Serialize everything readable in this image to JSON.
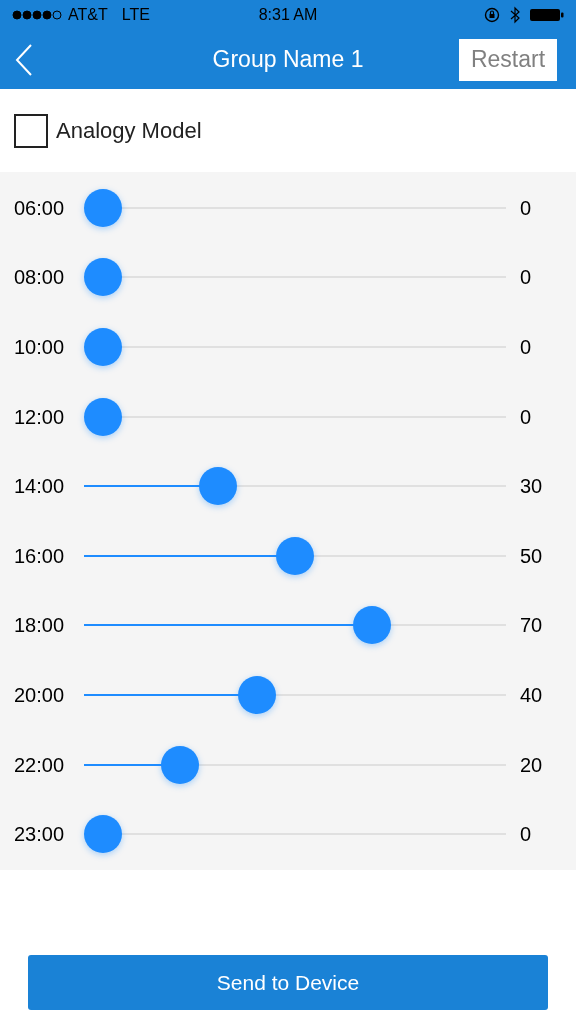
{
  "status_bar": {
    "carrier": "AT&T",
    "network": "LTE",
    "time": "8:31 AM"
  },
  "header": {
    "title": "Group Name 1",
    "action": "Restart"
  },
  "analogy_model": {
    "label": "Analogy Model",
    "checked": false
  },
  "sliders": [
    {
      "time": "06:00",
      "level": 0,
      "reading": "0"
    },
    {
      "time": "08:00",
      "level": 0,
      "reading": "0"
    },
    {
      "time": "10:00",
      "level": 0,
      "reading": "0"
    },
    {
      "time": "12:00",
      "level": 0,
      "reading": "0"
    },
    {
      "time": "14:00",
      "level": 0.3,
      "reading": "30"
    },
    {
      "time": "16:00",
      "level": 0.5,
      "reading": "50"
    },
    {
      "time": "18:00",
      "level": 0.7,
      "reading": "70"
    },
    {
      "time": "20:00",
      "level": 0.4,
      "reading": "40"
    },
    {
      "time": "22:00",
      "level": 0.2,
      "reading": "20"
    },
    {
      "time": "23:00",
      "level": 0,
      "reading": "0"
    }
  ],
  "send_button": "Send to Device"
}
